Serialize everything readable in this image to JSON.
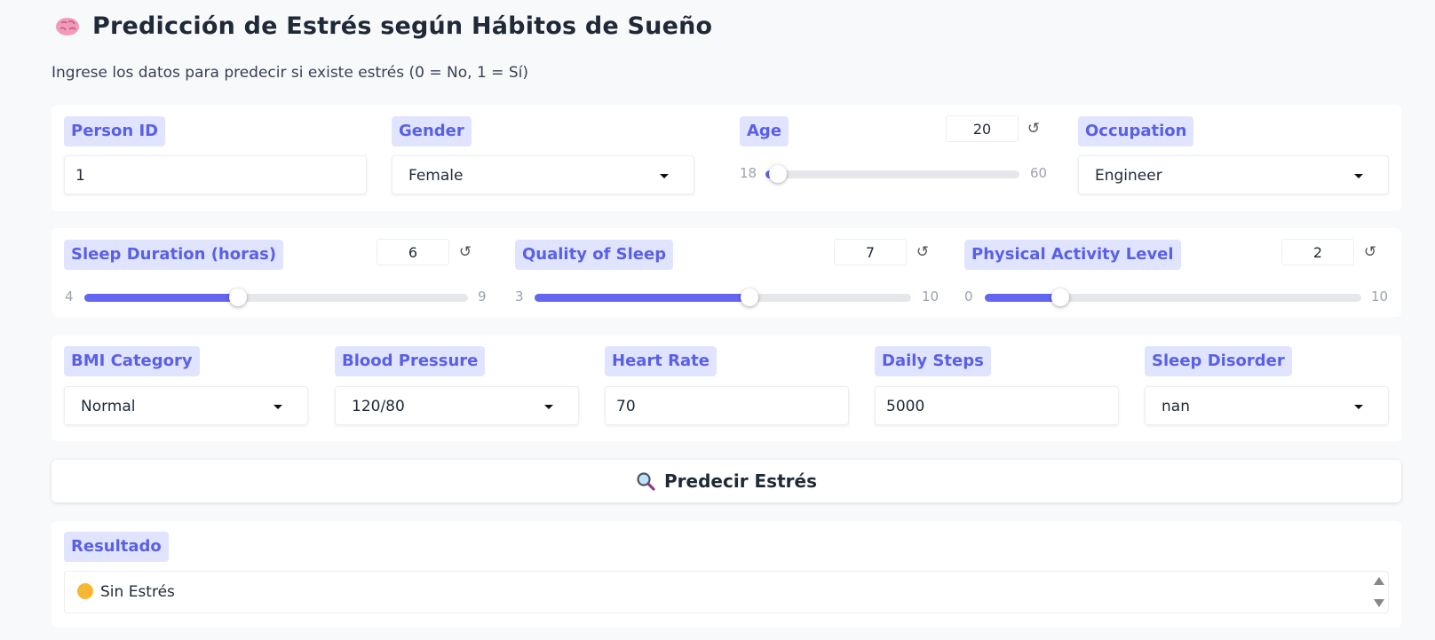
{
  "header": {
    "title": "Predicción de Estrés según Hábitos de Sueño",
    "icon": "brain-icon",
    "subtitle": "Ingrese los datos para predecir si existe estrés (0 = No, 1 = Sí)"
  },
  "row1": {
    "person_id": {
      "label": "Person ID",
      "value": "1"
    },
    "gender": {
      "label": "Gender",
      "value": "Female"
    },
    "age": {
      "label": "Age",
      "value": "20",
      "min": "18",
      "max": "60",
      "fraction": 0.048
    },
    "occupation": {
      "label": "Occupation",
      "value": "Engineer"
    }
  },
  "row2": {
    "sleep_duration": {
      "label": "Sleep Duration (horas)",
      "value": "6",
      "min": "4",
      "max": "9",
      "fraction": 0.4
    },
    "quality_of_sleep": {
      "label": "Quality of Sleep",
      "value": "7",
      "min": "3",
      "max": "10",
      "fraction": 0.571
    },
    "physical_activity": {
      "label": "Physical Activity Level",
      "value": "2",
      "min": "0",
      "max": "10",
      "fraction": 0.2
    }
  },
  "row3": {
    "bmi_category": {
      "label": "BMI Category",
      "value": "Normal"
    },
    "blood_pressure": {
      "label": "Blood Pressure",
      "value": "120/80"
    },
    "heart_rate": {
      "label": "Heart Rate",
      "value": "70"
    },
    "daily_steps": {
      "label": "Daily Steps",
      "value": "5000"
    },
    "sleep_disorder": {
      "label": "Sleep Disorder",
      "value": "nan"
    }
  },
  "actions": {
    "predict_label": "Predecir Estrés",
    "predict_icon": "magnifier-icon"
  },
  "result": {
    "label": "Resultado",
    "value": "Sin Estrés",
    "icon": "smiling-face-icon"
  },
  "reset_glyph": "↺",
  "colors": {
    "accent": "#6366f1",
    "label_bg": "#e0e4ff",
    "label_text": "#5a60e6"
  }
}
